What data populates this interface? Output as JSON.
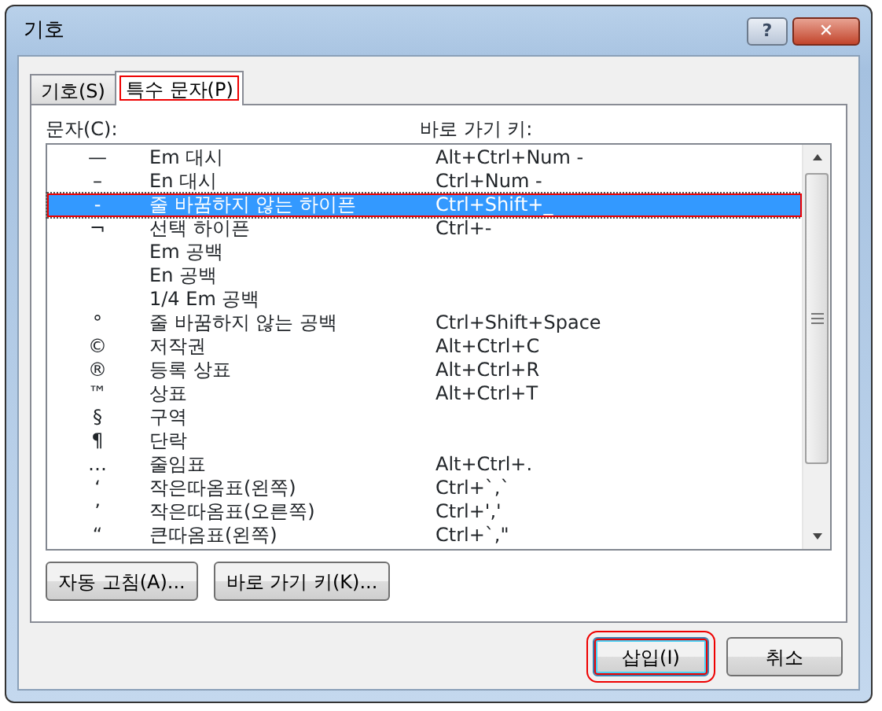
{
  "window": {
    "title": "기호"
  },
  "title_buttons": [
    {
      "kind": "help",
      "label": "?"
    },
    {
      "kind": "close",
      "label": "✕"
    }
  ],
  "tabs": [
    {
      "label": "기호(S)",
      "selected": false,
      "annotated": false
    },
    {
      "label": "특수 문자(P)",
      "selected": true,
      "annotated": true
    }
  ],
  "list": {
    "label": "문자(C):",
    "shortcut_label": "바로 가기 키:",
    "rows": [
      {
        "symbol": "—",
        "name": "Em 대시",
        "shortcut": "Alt+Ctrl+Num -",
        "selected": false,
        "annotated": false
      },
      {
        "symbol": "–",
        "name": "En 대시",
        "shortcut": "Ctrl+Num -",
        "selected": false,
        "annotated": false
      },
      {
        "symbol": "-",
        "name": "줄 바꿈하지 않는 하이픈",
        "shortcut": "Ctrl+Shift+_",
        "selected": true,
        "annotated": true
      },
      {
        "symbol": "¬",
        "name": "선택 하이픈",
        "shortcut": "Ctrl+-",
        "selected": false,
        "annotated": false
      },
      {
        "name": "Em 공백",
        "selected": false,
        "annotated": false
      },
      {
        "name": "En 공백",
        "selected": false,
        "annotated": false
      },
      {
        "name": "1/4 Em 공백",
        "selected": false,
        "annotated": false
      },
      {
        "symbol": "°",
        "name": "줄 바꿈하지 않는 공백",
        "shortcut": "Ctrl+Shift+Space",
        "selected": false,
        "annotated": false
      },
      {
        "symbol": "©",
        "name": "저작권",
        "shortcut": "Alt+Ctrl+C",
        "selected": false,
        "annotated": false
      },
      {
        "symbol": "®",
        "name": "등록 상표",
        "shortcut": "Alt+Ctrl+R",
        "selected": false,
        "annotated": false
      },
      {
        "symbol": "™",
        "name": "상표",
        "shortcut": "Alt+Ctrl+T",
        "selected": false,
        "annotated": false
      },
      {
        "symbol": "§",
        "name": "구역",
        "selected": false,
        "annotated": false
      },
      {
        "symbol": "¶",
        "name": "단락",
        "selected": false,
        "annotated": false
      },
      {
        "symbol": "…",
        "name": "줄임표",
        "shortcut": "Alt+Ctrl+.",
        "selected": false,
        "annotated": false
      },
      {
        "symbol": "‘",
        "name": "작은따옴표(왼쪽)",
        "shortcut": "Ctrl+`,`",
        "selected": false,
        "annotated": false
      },
      {
        "symbol": "’",
        "name": "작은따옴표(오른쪽)",
        "shortcut": "Ctrl+','",
        "selected": false,
        "annotated": false
      },
      {
        "symbol": "“",
        "name": "큰따옴표(왼쪽)",
        "shortcut": "Ctrl+`,\"",
        "selected": false,
        "annotated": false
      }
    ]
  },
  "panel_buttons": [
    {
      "label": "자동 고침(A)..."
    },
    {
      "label": "바로 가기 키(K)..."
    }
  ],
  "dialog_buttons": [
    {
      "label": "삽입(I)",
      "default": true,
      "annotated": true
    },
    {
      "label": "취소",
      "default": false,
      "annotated": false
    }
  ]
}
